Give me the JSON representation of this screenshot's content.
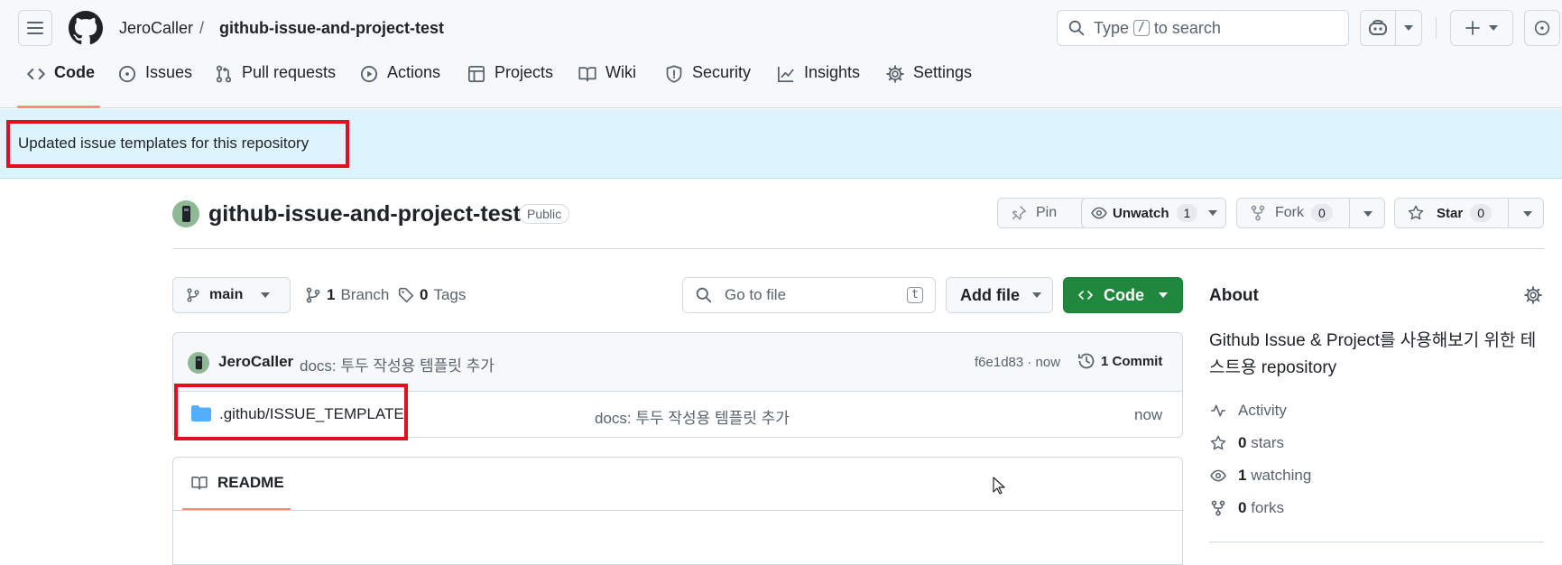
{
  "header": {
    "owner": "JeroCaller",
    "separator": "/",
    "repo": "github-issue-and-project-test",
    "search": {
      "prefix": "Type",
      "key": "/",
      "suffix": "to search"
    }
  },
  "tabs": [
    {
      "label": "Code",
      "icon": "code-icon",
      "selected": true
    },
    {
      "label": "Issues",
      "icon": "issue-opened-icon"
    },
    {
      "label": "Pull requests",
      "icon": "git-pull-request-icon"
    },
    {
      "label": "Actions",
      "icon": "play-icon"
    },
    {
      "label": "Projects",
      "icon": "table-icon"
    },
    {
      "label": "Wiki",
      "icon": "book-icon"
    },
    {
      "label": "Security",
      "icon": "shield-icon"
    },
    {
      "label": "Insights",
      "icon": "graph-icon"
    },
    {
      "label": "Settings",
      "icon": "gear-icon"
    }
  ],
  "flash": {
    "message": "Updated issue templates for this repository"
  },
  "repo_head": {
    "name": "github-issue-and-project-test",
    "visibility": "Public",
    "pin": "Pin",
    "unwatch": "Unwatch",
    "watch_count": "1",
    "fork": "Fork",
    "fork_count": "0",
    "star": "Star",
    "star_count": "0"
  },
  "toolbar": {
    "branch": "main",
    "branches_count": "1",
    "branches_label": "Branch",
    "tags_count": "0",
    "tags_label": "Tags",
    "goto_placeholder": "Go to file",
    "goto_key": "t",
    "add_file": "Add file",
    "code": "Code"
  },
  "commit": {
    "author": "JeroCaller",
    "message": "docs: 투두 작성용 템플릿 추가",
    "sha_time": "f6e1d83 · now",
    "commits": "1 Commit"
  },
  "files": [
    {
      "name": ".github/ISSUE_TEMPLATE",
      "message": "docs: 투두 작성용 템플릿 추가",
      "time": "now"
    }
  ],
  "readme": {
    "label": "README"
  },
  "about": {
    "title": "About",
    "description": "Github Issue & Project를 사용해보기 위한 테스트용 repository",
    "activity": "Activity",
    "stars_count": "0",
    "stars_label": "stars",
    "watching_count": "1",
    "watching_label": "watching",
    "forks_count": "0",
    "forks_label": "forks"
  },
  "colors": {
    "accent_green": "#1f883d",
    "flash_bg": "#ddf4ff",
    "highlight_red": "#e0101f",
    "tab_underline": "#fd8c73"
  }
}
